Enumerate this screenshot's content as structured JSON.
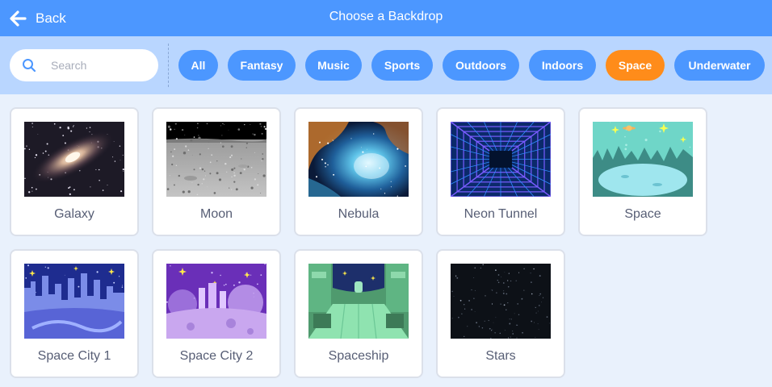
{
  "header": {
    "back_label": "Back",
    "title": "Choose a Backdrop"
  },
  "search": {
    "placeholder": "Search",
    "value": ""
  },
  "filters": {
    "active": "Space",
    "tags": [
      "All",
      "Fantasy",
      "Music",
      "Sports",
      "Outdoors",
      "Indoors",
      "Space",
      "Underwater"
    ]
  },
  "backdrops": [
    {
      "name": "Galaxy",
      "thumbnail": "galaxy"
    },
    {
      "name": "Moon",
      "thumbnail": "moon"
    },
    {
      "name": "Nebula",
      "thumbnail": "nebula"
    },
    {
      "name": "Neon Tunnel",
      "thumbnail": "neon-tunnel"
    },
    {
      "name": "Space",
      "thumbnail": "space"
    },
    {
      "name": "Space City 1",
      "thumbnail": "space-city-1"
    },
    {
      "name": "Space City 2",
      "thumbnail": "space-city-2"
    },
    {
      "name": "Spaceship",
      "thumbnail": "spaceship"
    },
    {
      "name": "Stars",
      "thumbnail": "stars"
    }
  ],
  "colors": {
    "header": "#4c97ff",
    "filter_bar": "#b9d6ff",
    "tag": "#4c97ff",
    "tag_active": "#ff8c1a",
    "background": "#e9f1fc"
  }
}
